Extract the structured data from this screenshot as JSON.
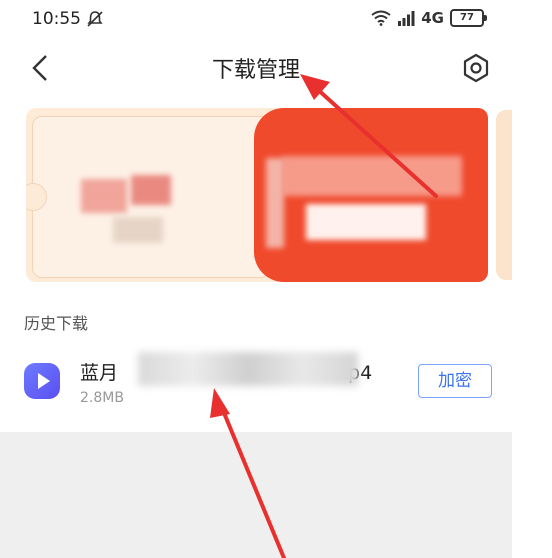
{
  "status_bar": {
    "time": "10:55",
    "network": "4G",
    "battery": "77"
  },
  "header": {
    "title": "下载管理"
  },
  "history": {
    "section_title": "历史下载",
    "items": [
      {
        "name_prefix": "蓝月",
        "name_suffix": "np4",
        "size": "2.8MB",
        "action_label": "加密"
      }
    ]
  },
  "colors": {
    "accent_blue": "#3d72f0",
    "banner_red": "#f04a2d",
    "annotation_red": "#e8312e"
  }
}
